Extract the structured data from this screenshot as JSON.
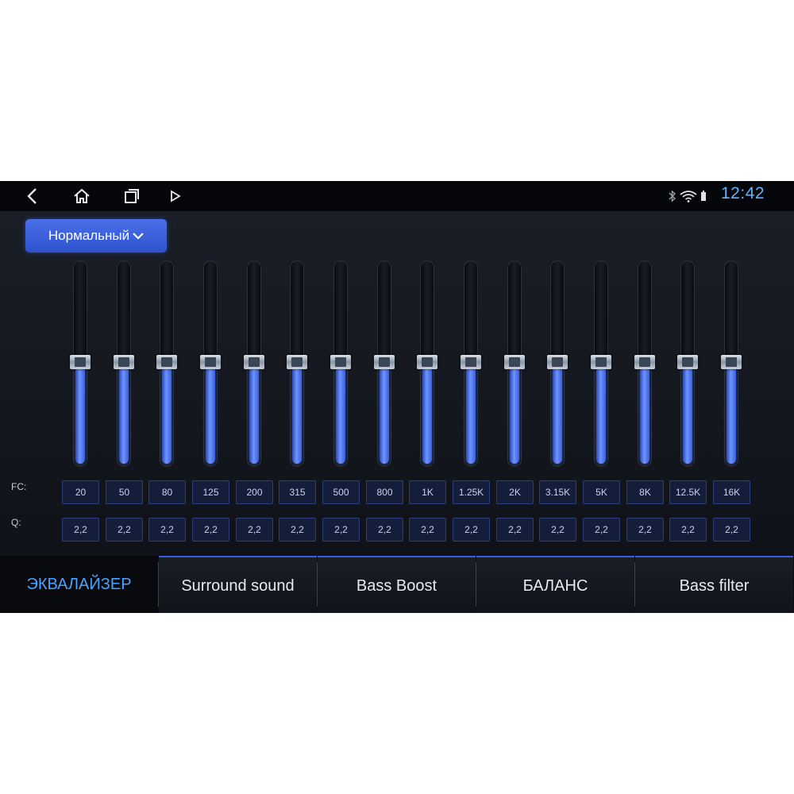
{
  "status": {
    "clock": "12:42",
    "icons": [
      "back-icon",
      "home-icon",
      "recent-apps-icon",
      "play-icon",
      "bluetooth-icon",
      "wifi-icon",
      "battery-icon"
    ]
  },
  "equalizer": {
    "preset": "Нормальный",
    "fc_label": "FC:",
    "q_label": "Q:",
    "level_fraction": 0.5,
    "bands": [
      {
        "fc": "20",
        "q": "2,2"
      },
      {
        "fc": "50",
        "q": "2,2"
      },
      {
        "fc": "80",
        "q": "2,2"
      },
      {
        "fc": "125",
        "q": "2,2"
      },
      {
        "fc": "200",
        "q": "2,2"
      },
      {
        "fc": "315",
        "q": "2,2"
      },
      {
        "fc": "500",
        "q": "2,2"
      },
      {
        "fc": "800",
        "q": "2,2"
      },
      {
        "fc": "1K",
        "q": "2,2"
      },
      {
        "fc": "1.25K",
        "q": "2,2"
      },
      {
        "fc": "2K",
        "q": "2,2"
      },
      {
        "fc": "3.15K",
        "q": "2,2"
      },
      {
        "fc": "5K",
        "q": "2,2"
      },
      {
        "fc": "8K",
        "q": "2,2"
      },
      {
        "fc": "12.5K",
        "q": "2,2"
      },
      {
        "fc": "16K",
        "q": "2,2"
      }
    ]
  },
  "tabs": [
    {
      "label": "ЭКВАЛАЙЗЕР",
      "active": true
    },
    {
      "label": "Surround sound",
      "active": false
    },
    {
      "label": "Bass Boost",
      "active": false
    },
    {
      "label": "БАЛАНС",
      "active": false
    },
    {
      "label": "Bass filter",
      "active": false
    }
  ],
  "colors": {
    "accent": "#4aa2ff",
    "slider_fill": "#6d95ff",
    "preset_button": "#3a5ee0"
  }
}
